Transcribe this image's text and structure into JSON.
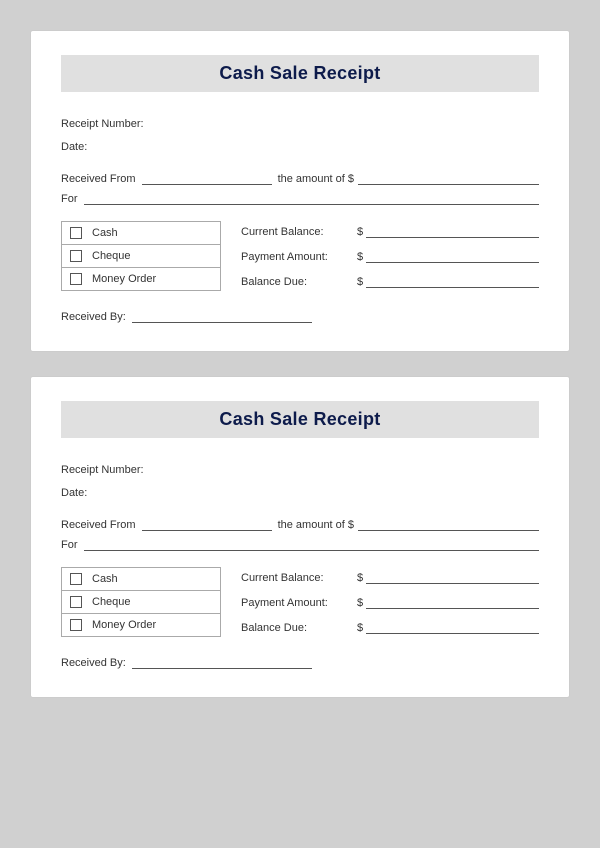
{
  "receipts": [
    {
      "id": "receipt-1",
      "title": "Cash Sale Receipt",
      "receipt_number_label": "Receipt Number:",
      "date_label": "Date:",
      "received_from_label": "Received From",
      "amount_of_label": "the amount of $",
      "for_label": "For",
      "payment_options": [
        {
          "label": "Cash"
        },
        {
          "label": "Cheque"
        },
        {
          "label": "Money Order"
        }
      ],
      "current_balance_label": "Current Balance:",
      "payment_amount_label": "Payment Amount:",
      "balance_due_label": "Balance Due:",
      "dollar": "$",
      "received_by_label": "Received By:"
    },
    {
      "id": "receipt-2",
      "title": "Cash Sale Receipt",
      "receipt_number_label": "Receipt Number:",
      "date_label": "Date:",
      "received_from_label": "Received From",
      "amount_of_label": "the amount of $",
      "for_label": "For",
      "payment_options": [
        {
          "label": "Cash"
        },
        {
          "label": "Cheque"
        },
        {
          "label": "Money Order"
        }
      ],
      "current_balance_label": "Current Balance:",
      "payment_amount_label": "Payment Amount:",
      "balance_due_label": "Balance Due:",
      "dollar": "$",
      "received_by_label": "Received By:"
    }
  ]
}
